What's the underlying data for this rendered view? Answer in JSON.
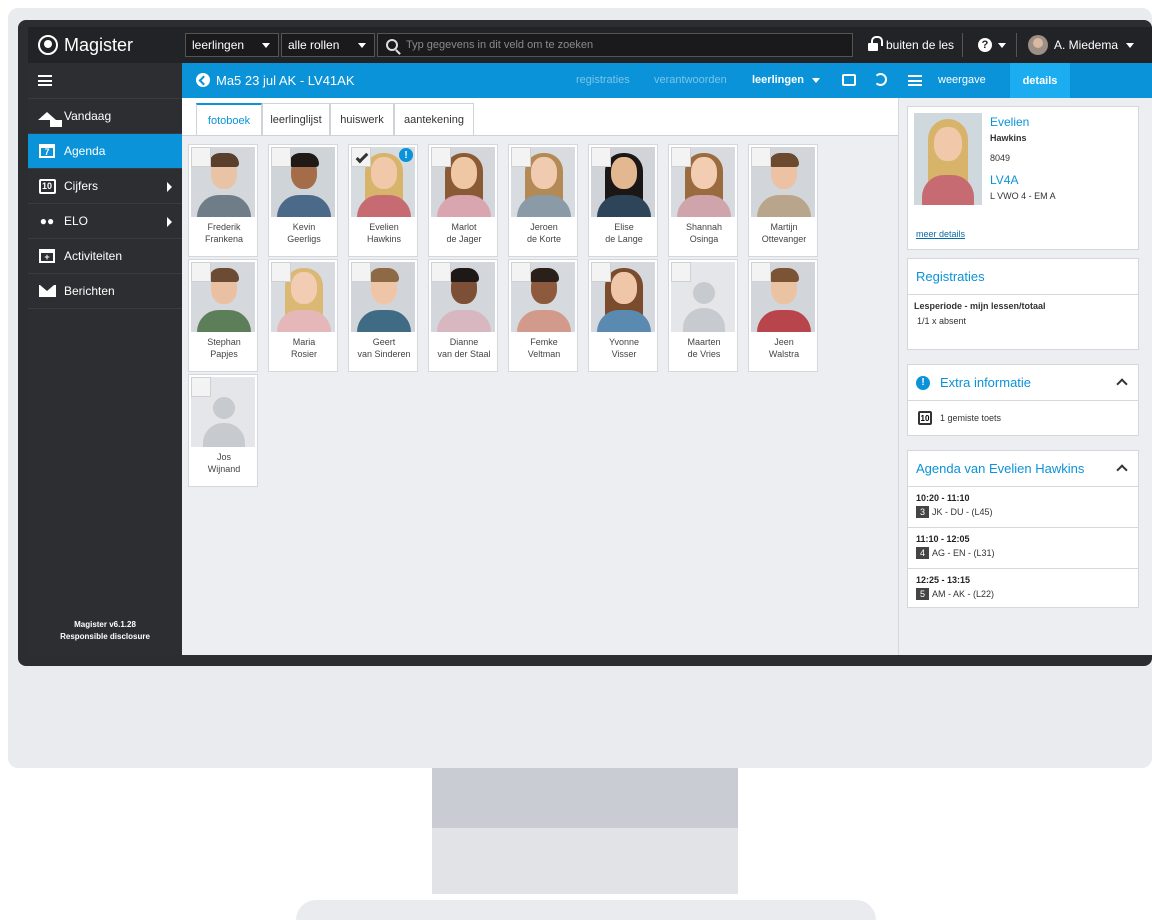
{
  "app": {
    "brand": "Magister"
  },
  "topbar": {
    "select1": "leerlingen",
    "select2": "alle rollen",
    "search_placeholder": "Typ gegevens in dit veld om te zoeken",
    "lock_label": "buiten de les",
    "help_label": "?",
    "user_name": "A. Miedema"
  },
  "sidebar": {
    "items": [
      {
        "label": "Vandaag",
        "icon": "home-icon"
      },
      {
        "label": "Agenda",
        "icon": "calendar-icon",
        "cal_day": "7"
      },
      {
        "label": "Cijfers",
        "icon": "grades-icon",
        "badge": "10"
      },
      {
        "label": "ELO",
        "icon": "users-icon"
      },
      {
        "label": "Activiteiten",
        "icon": "calendar-plus-icon"
      },
      {
        "label": "Berichten",
        "icon": "envelope-icon"
      }
    ],
    "version": "Magister v6.1.28",
    "disclosure": "Responsible disclosure"
  },
  "content": {
    "title": "Ma5 23 jul AK - LV41AK",
    "links": [
      "registraties",
      "verantwoorden",
      "leerlingen"
    ],
    "tabs": [
      "fotoboek",
      "leerlinglijst",
      "huiswerk",
      "aantekening"
    ],
    "active_tab": "fotoboek"
  },
  "students": [
    {
      "first": "Frederik",
      "last": "Frankena"
    },
    {
      "first": "Kevin",
      "last": "Geerligs"
    },
    {
      "first": "Evelien",
      "last": "Hawkins",
      "selected": true,
      "alert": "!"
    },
    {
      "first": "Marlot",
      "last": "de Jager"
    },
    {
      "first": "Jeroen",
      "last": "de Korte"
    },
    {
      "first": "Elise",
      "last": "de Lange"
    },
    {
      "first": "Shannah",
      "last": "Osinga"
    },
    {
      "first": "Martijn",
      "last": "Ottevanger"
    },
    {
      "first": "Stephan",
      "last": "Papjes"
    },
    {
      "first": "Maria",
      "last": "Rosier"
    },
    {
      "first": "Geert",
      "last": "van Sinderen"
    },
    {
      "first": "Dianne",
      "last": "van der Staal"
    },
    {
      "first": "Femke",
      "last": "Veltman"
    },
    {
      "first": "Yvonne",
      "last": "Visser"
    },
    {
      "first": "Maarten",
      "last": "de Vries"
    },
    {
      "first": "Jeen",
      "last": "Walstra"
    },
    {
      "first": "Jos",
      "last": "Wijnand"
    }
  ],
  "right": {
    "weergave": "weergave",
    "details": "details",
    "student_first": "Evelien",
    "student_last": "Hawkins",
    "student_number": "8049",
    "class": "LV4A",
    "class_desc": "L VWO 4 - EM A",
    "meer_details": "meer details",
    "registraties": {
      "title": "Registraties",
      "period": "Lesperiode - mijn lessen/totaal",
      "value": "1/1 x absent"
    },
    "extra": {
      "title": "Extra informatie",
      "icon_label": "10",
      "text": "1 gemiste toets"
    },
    "agenda": {
      "title": "Agenda van Evelien Hawkins",
      "items": [
        {
          "time": "10:20 - 11:10",
          "hour": "3",
          "desc": "JK - DU - (L45)"
        },
        {
          "time": "11:10 - 12:05",
          "hour": "4",
          "desc": "AG - EN - (L31)"
        },
        {
          "time": "12:25 - 13:15",
          "hour": "5",
          "desc": "AM - AK - (L22)"
        }
      ]
    }
  }
}
